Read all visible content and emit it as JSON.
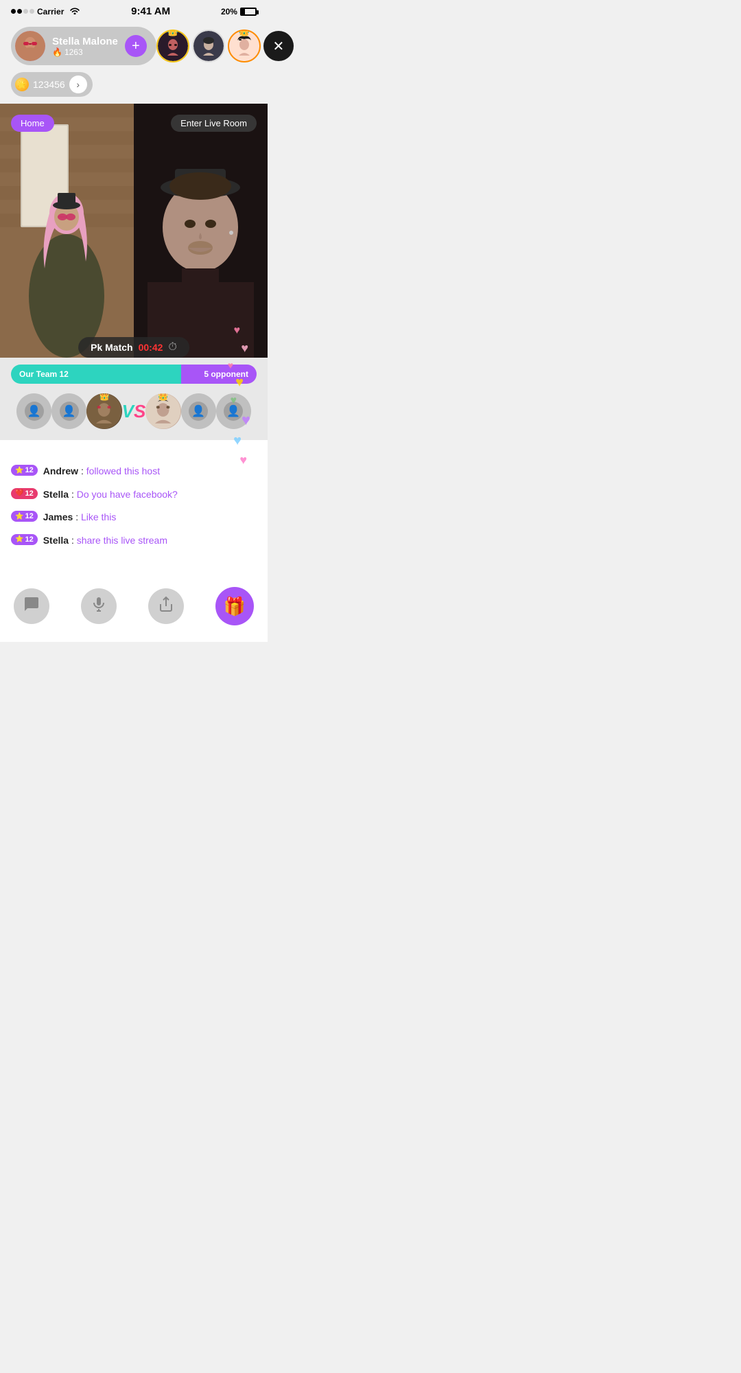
{
  "statusBar": {
    "carrier": "Carrier",
    "time": "9:41 AM",
    "battery": "20%"
  },
  "profile": {
    "name": "Stella Malone",
    "flame_count": "1263",
    "add_label": "+",
    "coin_value": "123456"
  },
  "viewers": [
    {
      "id": "viewer-1",
      "has_crown": true,
      "crown_type": "gold"
    },
    {
      "id": "viewer-2",
      "has_crown": false
    },
    {
      "id": "viewer-3",
      "has_crown": true,
      "crown_type": "orange"
    }
  ],
  "liveVideo": {
    "home_label": "Home",
    "enter_live_label": "Enter Live Room"
  },
  "pkMatch": {
    "label": "Pk Match",
    "timer": "00:42"
  },
  "scoreBar": {
    "our_team": "Our Team 12",
    "opponent": "5 opponent"
  },
  "chat": [
    {
      "badge_type": "star",
      "badge_num": "12",
      "user": "Andrew",
      "message": "followed this host"
    },
    {
      "badge_type": "heart",
      "badge_num": "12",
      "user": "Stella",
      "message": "Do you have facebook?"
    },
    {
      "badge_type": "star",
      "badge_num": "12",
      "user": "James",
      "message": "Like this"
    },
    {
      "badge_type": "star",
      "badge_num": "12",
      "user": "Stella",
      "message": "share this live stream"
    }
  ],
  "hearts": [
    "🩷",
    "💛",
    "💚",
    "💜",
    "🩵",
    "💗",
    "🩷"
  ],
  "toolbar": {
    "chat_icon": "💬",
    "mic_icon": "🎤",
    "share_icon": "⬆",
    "gift_icon": "🎁"
  }
}
